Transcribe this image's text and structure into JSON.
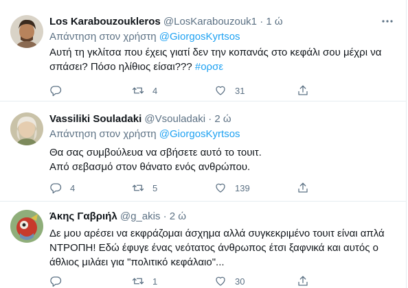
{
  "tweets": [
    {
      "name": "Los Karabouzoukleros",
      "handle": "@LosKarabouzouk1",
      "dot": "·",
      "time": "1 ώ",
      "reply_prefix": "Απάντηση στον χρήστη",
      "reply_to": "@GiorgosKyrtsos",
      "text_lines": [
        "Αυτή τη γκλίτσα που έχεις γιατί δεν την κοπανάς στο κεφάλι σου μέχρι να",
        "σπάσει? Πόσο ηλίθιος είσαι???"
      ],
      "hashtag": "#ορσε",
      "replies": "",
      "retweets": "4",
      "likes": "31"
    },
    {
      "name": "Vassiliki Souladaki",
      "handle": "@Vsouladaki",
      "dot": "·",
      "time": "2 ώ",
      "reply_prefix": "Απάντηση στον χρήστη",
      "reply_to": "@GiorgosKyrtsos",
      "text_lines": [
        "Θα σας συμβούλευα να σβήσετε αυτό το τουιτ.",
        "Από σεβασμό στον θάνατο ενός ανθρώπου."
      ],
      "replies": "4",
      "retweets": "5",
      "likes": "139"
    },
    {
      "name": "Άκης Γαβριήλ",
      "handle": "@g_akis",
      "dot": "·",
      "time": "2 ώ",
      "text_lines": [
        "Δε μου αρέσει να εκφράζομαι άσχημα αλλά συγκεκριμένο τουιτ είναι απλά",
        "ΝΤΡΟΠΗ! Εδώ έφυγε ένας νεότατος άνθρωπος έτσι ξαφνικά και αυτός ο",
        "άθλιος μιλάει για \"πολιτικό κεφάλαιο\"..."
      ],
      "replies": "",
      "retweets": "1",
      "likes": "30"
    }
  ],
  "icons": {
    "reply": "reply-icon",
    "retweet": "retweet-icon",
    "like": "heart-icon",
    "share": "share-icon",
    "more": "more-icon"
  },
  "colors": {
    "link": "#1da1f2",
    "secondary_text": "#5b7083",
    "primary_text": "#0f1419",
    "divider": "#e6ecf0"
  }
}
